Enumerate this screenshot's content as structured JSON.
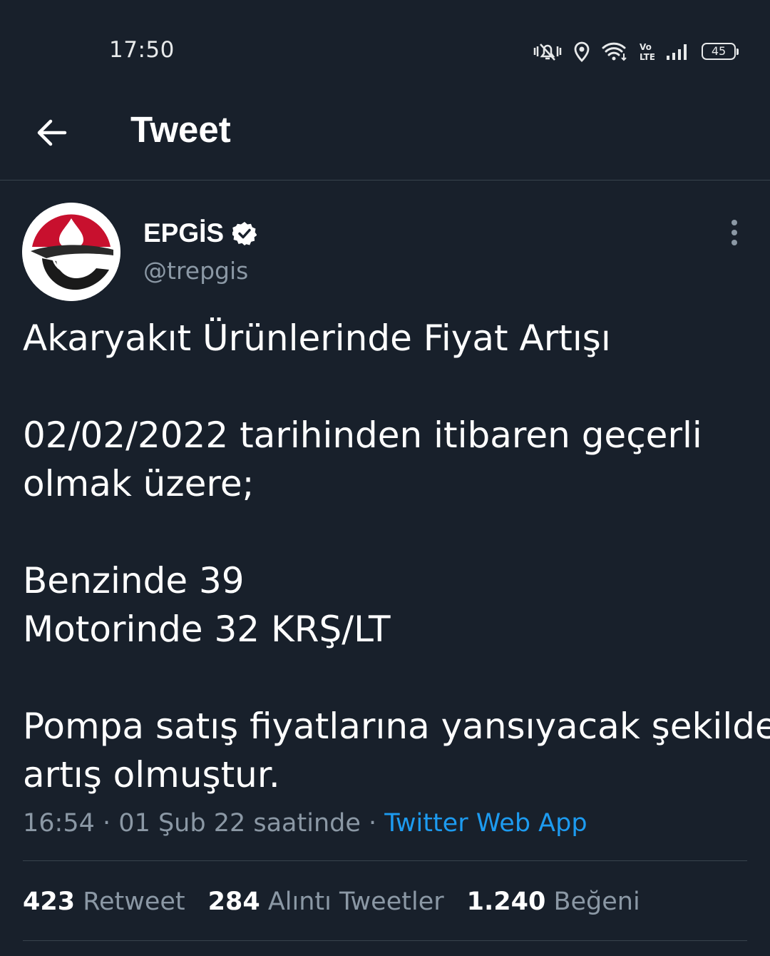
{
  "status_bar": {
    "time": "17:50",
    "battery": "45",
    "icons": [
      "vibrate-mute-icon",
      "location-icon",
      "wifi-icon",
      "volte-icon",
      "signal-icon",
      "battery-icon"
    ]
  },
  "header": {
    "back_icon": "arrow-left-icon",
    "title": "Tweet"
  },
  "tweet": {
    "author": {
      "name": "EPGİS",
      "verified": true,
      "handle": "@trepgis"
    },
    "text_lines": [
      "Akaryakıt Ürünlerinde Fiyat Artışı",
      "",
      "02/02/2022 tarihinden itibaren geçerli",
      "olmak üzere;",
      "",
      "Benzinde 39",
      "Motorinde 32 KRŞ/LT",
      "",
      "Pompa satış fiyatlarına yansıyacak şekilde",
      "artış olmuştur."
    ],
    "meta": {
      "time": "16:54",
      "date": "01 Şub 22 saatinde",
      "separator": "·",
      "source": "Twitter Web App"
    },
    "stats": {
      "retweets": {
        "count": "423",
        "label": "Retweet"
      },
      "quotes": {
        "count": "284",
        "label": "Alıntı Tweetler"
      },
      "likes": {
        "count": "1.240",
        "label": "Beğeni"
      }
    }
  },
  "colors": {
    "background": "#18202b",
    "text_secondary": "#8b98a5",
    "link": "#1d9bf0",
    "divider": "#38444d",
    "logo_red": "#c8102e"
  }
}
